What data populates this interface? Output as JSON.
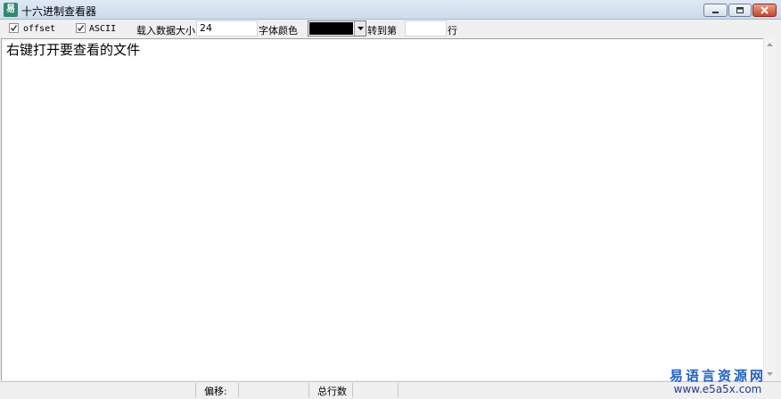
{
  "window": {
    "title": "十六进制查看器",
    "app_icon_glyph": "易",
    "minimize_icon": "minimize-icon",
    "maximize_icon": "maximize-icon",
    "close_icon": "close-icon"
  },
  "toolbar": {
    "offset_label": "offset",
    "offset_checked": true,
    "ascii_label": "ASCII",
    "ascii_checked": true,
    "load_size_label": "载入数据大小",
    "load_size_value": "24",
    "font_color_label": "字体颜色",
    "font_color_value": "#000000",
    "goto_label": "转到第",
    "goto_value": "",
    "goto_suffix": "行"
  },
  "content": {
    "placeholder": "右键打开要查看的文件"
  },
  "statusbar": {
    "offset_label": "偏移:",
    "total_rows_label": "总行数"
  },
  "watermark": {
    "name": "易语言资源网",
    "url": "www.e5a5x.com"
  }
}
